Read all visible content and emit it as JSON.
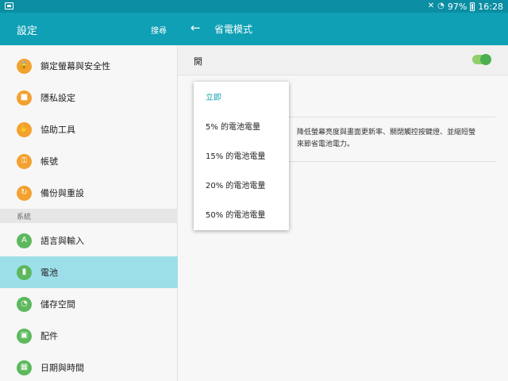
{
  "status_bar": {
    "mute_icon": "mute-icon",
    "wifi_icon": "wifi-icon",
    "battery_percent": "97%",
    "time": "16:28"
  },
  "left_header": {
    "title": "設定",
    "search_label": "搜尋"
  },
  "right_header": {
    "back_icon": "arrow-left-icon",
    "title": "省電模式"
  },
  "sidebar": {
    "items": [
      {
        "label": "鎖定螢幕與安全性",
        "icon": "lock-icon",
        "color": "#f3a12f"
      },
      {
        "label": "隱私設定",
        "icon": "privacy-icon",
        "color": "#f3a12f"
      },
      {
        "label": "協助工具",
        "icon": "hand-icon",
        "color": "#f3a12f"
      },
      {
        "label": "帳號",
        "icon": "key-icon",
        "color": "#f3a12f"
      },
      {
        "label": "備份與重設",
        "icon": "backup-icon",
        "color": "#f3a12f"
      }
    ],
    "section_label": "系統",
    "system_items": [
      {
        "label": "語言與輸入",
        "icon": "language-icon",
        "color": "#5cb85c"
      },
      {
        "label": "電池",
        "icon": "battery-icon",
        "color": "#5cb85c",
        "selected": true
      },
      {
        "label": "儲存空間",
        "icon": "storage-icon",
        "color": "#5cb85c"
      },
      {
        "label": "配件",
        "icon": "accessory-icon",
        "color": "#5cb85c"
      },
      {
        "label": "日期與時間",
        "icon": "calendar-icon",
        "color": "#5cb85c"
      }
    ]
  },
  "content": {
    "toggle_label": "開",
    "toggle_on": true,
    "description_line1": "降低螢幕亮度與畫面更新率、關閉觸控按鍵燈、並縮短螢",
    "description_line2": "來節省電池電力。"
  },
  "dropdown": {
    "options": [
      {
        "label": "立即",
        "selected": true
      },
      {
        "label": "5% 的電池電量",
        "selected": false
      },
      {
        "label": "15% 的電池電量",
        "selected": false
      },
      {
        "label": "20% 的電池電量",
        "selected": false
      },
      {
        "label": "50% 的電池電量",
        "selected": false
      }
    ]
  },
  "colors": {
    "accent": "#0fa0b5",
    "status_bar": "#0b8ea3",
    "selected_row": "#9ddfe9",
    "orange_icon": "#f3a12f",
    "green_icon": "#5cb85c",
    "switch_on": "#4caf50"
  }
}
